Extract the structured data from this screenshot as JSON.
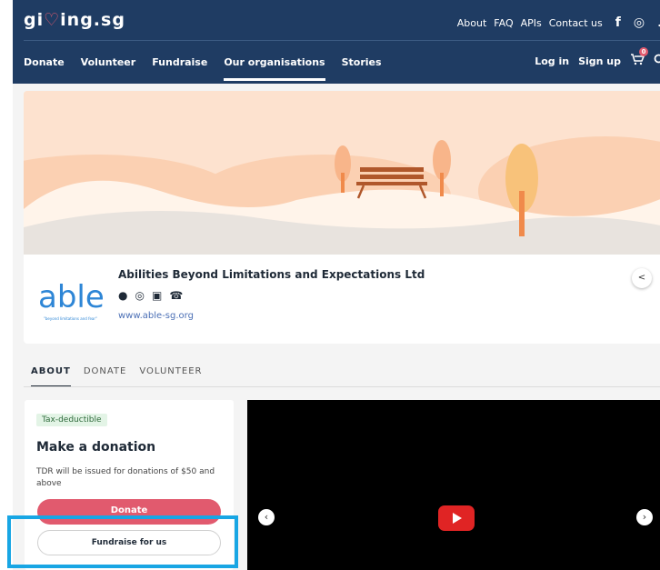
{
  "header": {
    "brand_pre": "gi",
    "brand_heart": "♡",
    "brand_post": "ing.sg",
    "top_links": [
      "About",
      "FAQ",
      "APIs",
      "Contact us"
    ],
    "social_icons": [
      "facebook-icon",
      "instagram-icon",
      "tiktok-icon"
    ],
    "nav": [
      "Donate",
      "Volunteer",
      "Fundraise",
      "Our organisations",
      "Stories"
    ],
    "active_nav": "Our organisations",
    "login": "Log in",
    "signup": "Sign up",
    "cart_count": "0"
  },
  "org": {
    "name": "Abilities Beyond Limitations and Expectations Ltd",
    "logo_text": "able",
    "logo_tagline": "\"beyond limitations and fear\"",
    "website": "www.able-sg.org",
    "social_icons": [
      "facebook-icon",
      "instagram-icon",
      "linkedin-icon",
      "phone-icon"
    ]
  },
  "tabs": [
    "ABOUT",
    "DONATE",
    "VOLUNTEER"
  ],
  "active_tab": "ABOUT",
  "donation": {
    "badge": "Tax-deductible",
    "title": "Make a donation",
    "description": "TDR will be issued for donations of $50 and above",
    "donate_label": "Donate",
    "fundraise_label": "Fundraise for us"
  },
  "colors": {
    "navy": "#1f3c63",
    "accent": "#e15a6e",
    "highlight": "#18a6e4"
  }
}
